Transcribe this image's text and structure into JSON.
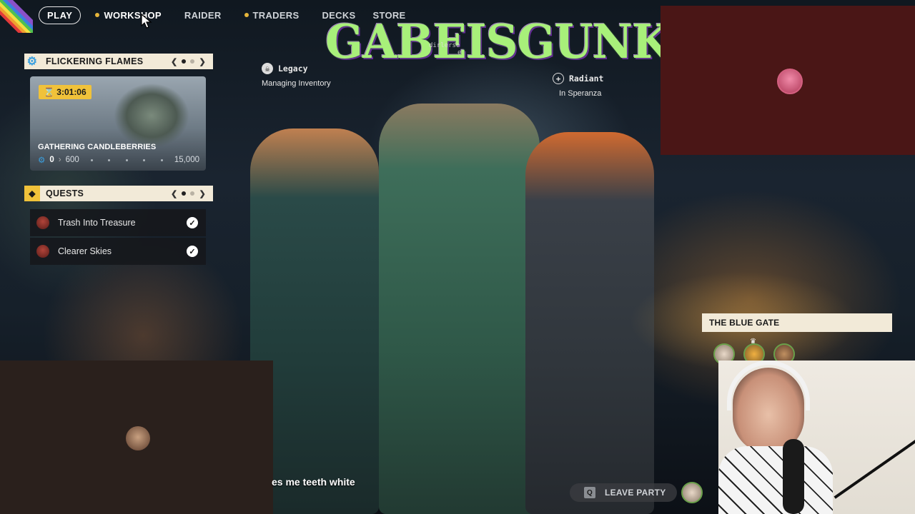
{
  "nav": {
    "play": "PLAY",
    "items": [
      {
        "label": "WORKSHOP",
        "dot": true
      },
      {
        "label": "RAIDER",
        "dot": false
      },
      {
        "label": "TRADERS",
        "dot": true
      },
      {
        "label": "DECKS",
        "dot": false
      },
      {
        "label": "STORE",
        "dot": false
      }
    ]
  },
  "event": {
    "header": "FLICKERING FLAMES",
    "timer": "3:01:06",
    "name": "GATHERING CANDLEBERRIES",
    "current": "0",
    "milestone": "600",
    "goal": "15,000"
  },
  "quests": {
    "header": "QUESTS",
    "items": [
      {
        "label": "Trash Into Treasure",
        "completed": true
      },
      {
        "label": "Clearer Skies",
        "completed": true
      }
    ]
  },
  "overlay": {
    "title": "GABEISGUNK",
    "sub_line1": "dirlerse",
    "sub_line2": "e"
  },
  "party_status": {
    "left_name": "Legacy",
    "left_status": "Managing Inventory",
    "right_name": "Radiant",
    "right_status": "In Speranza"
  },
  "lobby": {
    "title": "THE BLUE GATE",
    "leave_label": "LEAVE PARTY",
    "leave_key": "Q"
  },
  "subtitle": "es me teeth white",
  "colors": {
    "accent_yellow": "#f0c23a",
    "panel_cream": "#f2ead8",
    "overlay_green": "#a8f07a",
    "cam_maroon": "#4a1616"
  }
}
